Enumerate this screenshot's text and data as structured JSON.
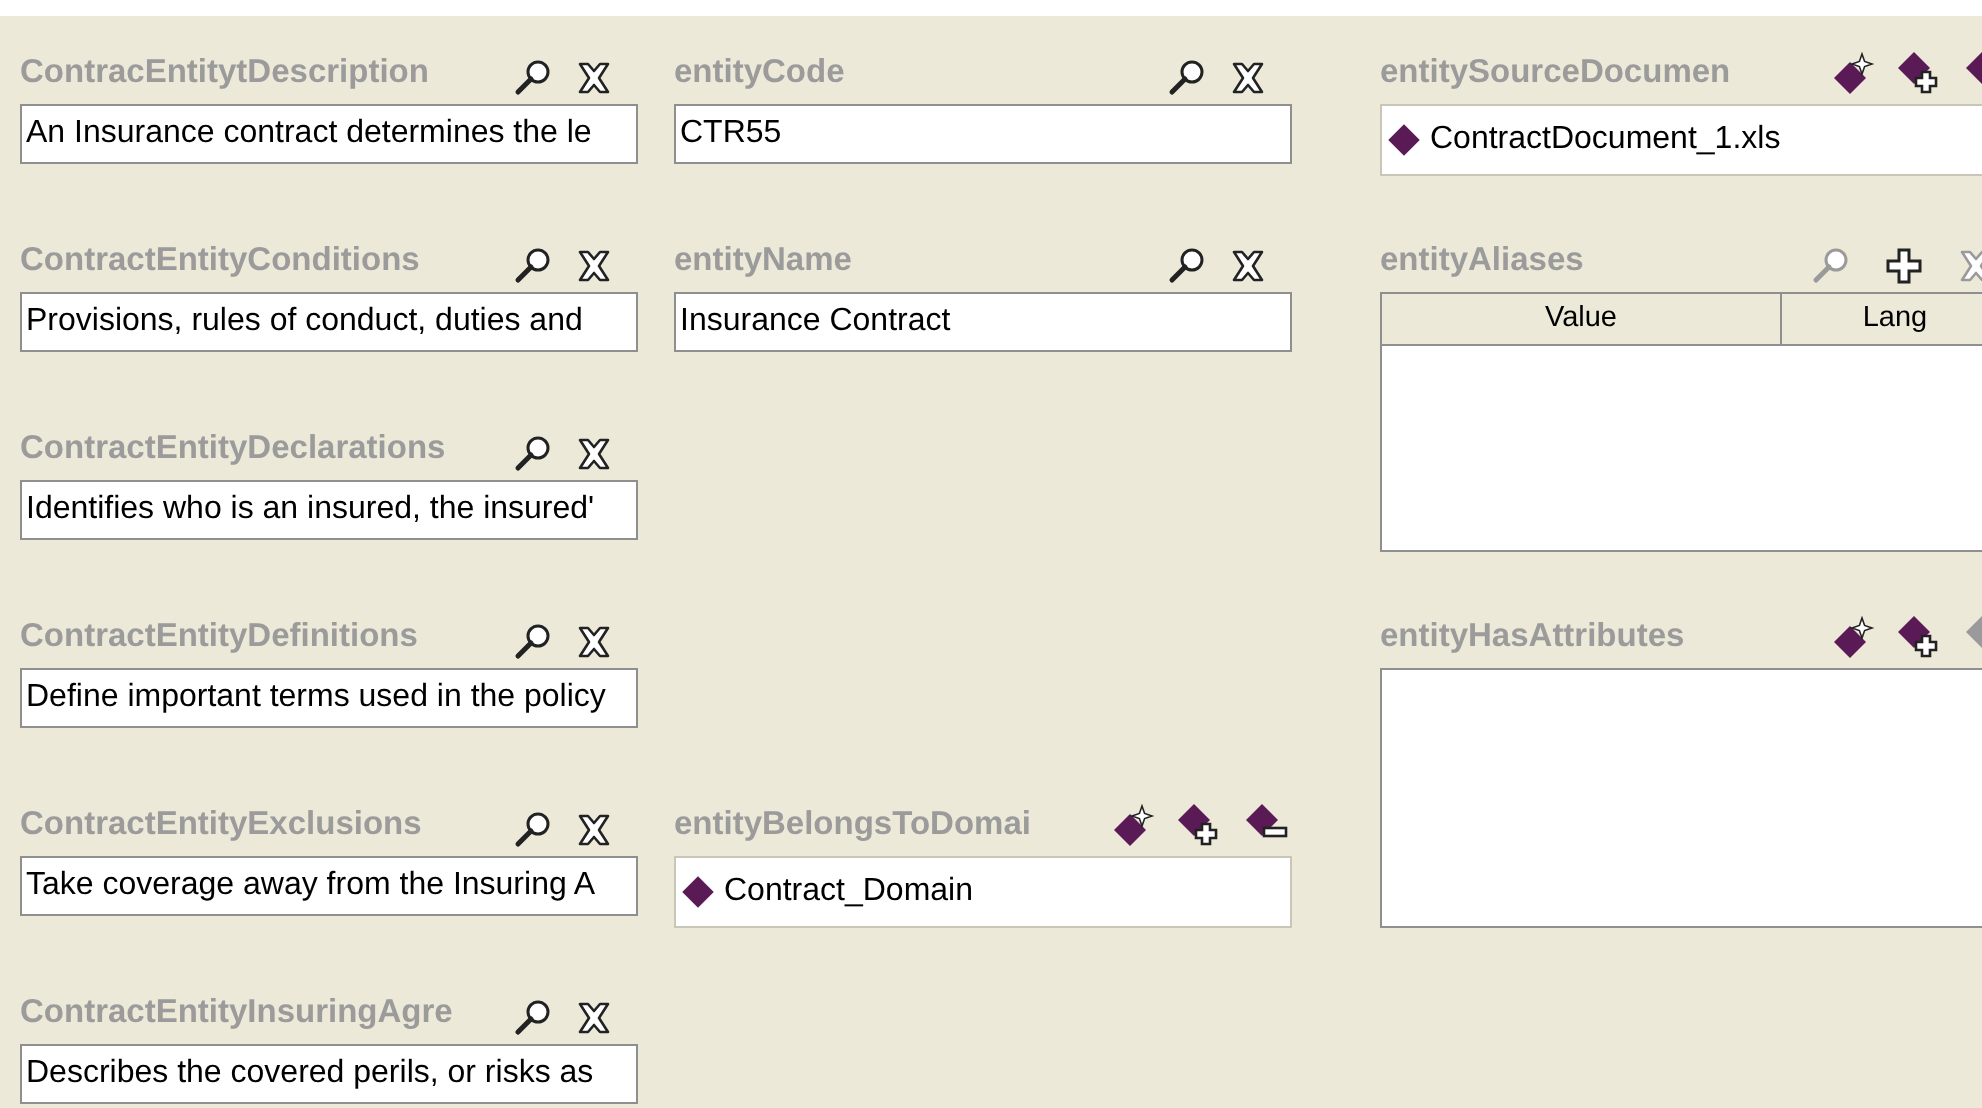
{
  "columns": [
    {
      "widgets": [
        {
          "kind": "text",
          "label": "ContracEntitytDescription",
          "actions": [
            {
              "kind": "search",
              "disabled": false
            },
            {
              "kind": "delete",
              "disabled": false
            }
          ],
          "value": "An Insurance contract determines the le"
        },
        {
          "kind": "text",
          "label": "ContractEntityConditions",
          "actions": [
            {
              "kind": "search",
              "disabled": false
            },
            {
              "kind": "delete",
              "disabled": false
            }
          ],
          "value": "Provisions, rules of conduct, duties and"
        },
        {
          "kind": "text",
          "label": "ContractEntityDeclarations",
          "actions": [
            {
              "kind": "search",
              "disabled": false
            },
            {
              "kind": "delete",
              "disabled": false
            }
          ],
          "value": "Identifies who is an insured, the insured'"
        },
        {
          "kind": "text",
          "label": "ContractEntityDefinitions",
          "actions": [
            {
              "kind": "search",
              "disabled": false
            },
            {
              "kind": "delete",
              "disabled": false
            }
          ],
          "value": "Define important terms used in the policy"
        },
        {
          "kind": "text",
          "label": "ContractEntityExclusions",
          "actions": [
            {
              "kind": "search",
              "disabled": false
            },
            {
              "kind": "delete",
              "disabled": false
            }
          ],
          "value": "Take coverage away from the Insuring A"
        },
        {
          "kind": "text",
          "label": "ContractEntityInsuringAgre",
          "actions": [
            {
              "kind": "search",
              "disabled": false
            },
            {
              "kind": "delete",
              "disabled": false
            }
          ],
          "value": "Describes the covered perils, or risks as"
        }
      ]
    },
    {
      "widgets": [
        {
          "kind": "text",
          "label": "entityCode",
          "actions": [
            {
              "kind": "search",
              "disabled": false
            },
            {
              "kind": "delete",
              "disabled": false
            }
          ],
          "value": "CTR55"
        },
        {
          "kind": "text",
          "label": "entityName",
          "actions": [
            {
              "kind": "search",
              "disabled": false
            },
            {
              "kind": "delete",
              "disabled": false
            }
          ],
          "value": "Insurance Contract"
        },
        {
          "kind": "instances",
          "label": "entityBelongsToDomai",
          "actions": [
            {
              "kind": "create",
              "disabled": false
            },
            {
              "kind": "add-instance",
              "disabled": false
            },
            {
              "kind": "remove-instance",
              "disabled": false
            }
          ],
          "items": [
            "Contract_Domain"
          ]
        }
      ]
    },
    {
      "widgets": [
        {
          "kind": "instances",
          "label": "entitySourceDocumen",
          "actions": [
            {
              "kind": "create",
              "disabled": false
            },
            {
              "kind": "add-instance",
              "disabled": false
            },
            {
              "kind": "remove-instance",
              "disabled": false
            }
          ],
          "items": [
            "ContractDocument_1.xls"
          ]
        },
        {
          "kind": "table",
          "label": "entityAliases",
          "actions": [
            {
              "kind": "search",
              "disabled": true
            },
            {
              "kind": "add",
              "disabled": false
            },
            {
              "kind": "delete",
              "disabled": true
            }
          ],
          "columns": [
            "Value",
            "Lang"
          ]
        },
        {
          "kind": "list",
          "label": "entityHasAttributes",
          "actions": [
            {
              "kind": "create",
              "disabled": false
            },
            {
              "kind": "add-instance",
              "disabled": false
            },
            {
              "kind": "remove-instance",
              "disabled": true
            }
          ]
        }
      ]
    }
  ]
}
